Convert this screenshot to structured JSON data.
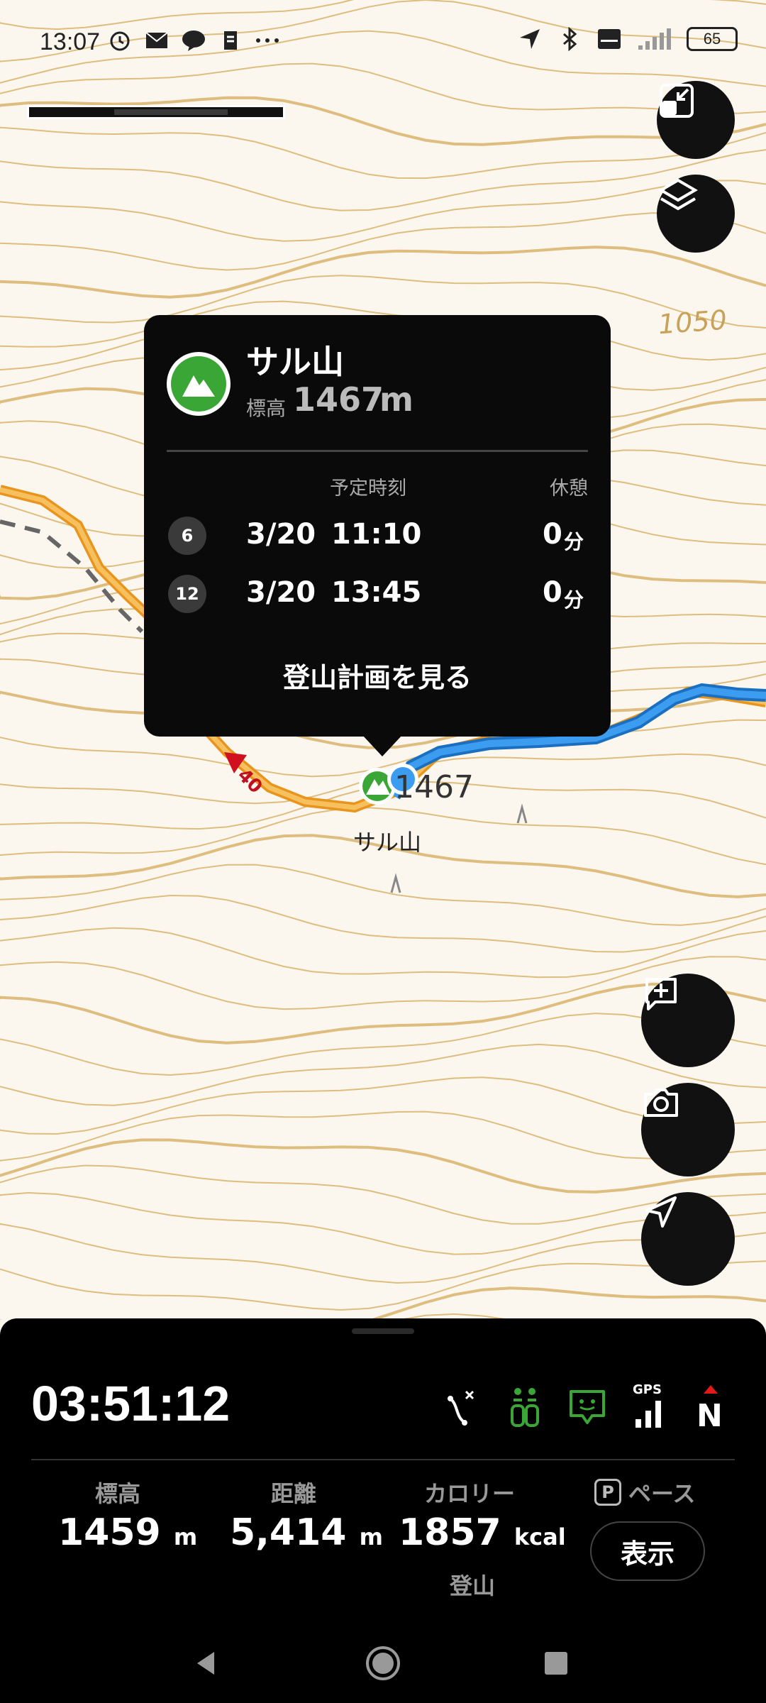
{
  "status_bar": {
    "time": "13:07",
    "battery": "65",
    "left_icons": [
      "alarm-icon",
      "mail-icon",
      "line-icon",
      "app-icon",
      "more-icon"
    ],
    "right_icons": [
      "location-arrow-icon",
      "bluetooth-icon",
      "volte-icon",
      "signal-icon"
    ]
  },
  "map": {
    "peak_name_label": "サル山",
    "elevation_label": "1467",
    "contour_label": "1050",
    "waypoint_label": "40",
    "colors": {
      "route": "#f2a83a",
      "track": "#2f8fe0",
      "contour": "#d8b36a",
      "peak": "#3aa635"
    }
  },
  "popup": {
    "name": "サル山",
    "altitude_label": "標高",
    "altitude_value": "1467",
    "altitude_unit": "m",
    "col_time": "予定時刻",
    "col_rest": "休憩",
    "rows": [
      {
        "num": "6",
        "date": "3/20",
        "time": "11:10",
        "rest": "0",
        "rest_unit": "分"
      },
      {
        "num": "12",
        "date": "3/20",
        "time": "13:45",
        "rest": "0",
        "rest_unit": "分"
      }
    ],
    "link": "登山計画を見る"
  },
  "panel": {
    "elapsed": "03:51:12",
    "gps_label": "GPS",
    "compass_label": "N",
    "stats": {
      "altitude": {
        "label": "標高",
        "value": "1459",
        "unit": "m"
      },
      "distance": {
        "label": "距離",
        "value": "5,414",
        "unit": "m"
      },
      "calorie": {
        "label": "カロリー",
        "value": "1857",
        "unit": "kcal"
      },
      "pace": {
        "badge": "P",
        "label": "ペース",
        "button": "表示"
      }
    },
    "climb_label": "登山"
  }
}
